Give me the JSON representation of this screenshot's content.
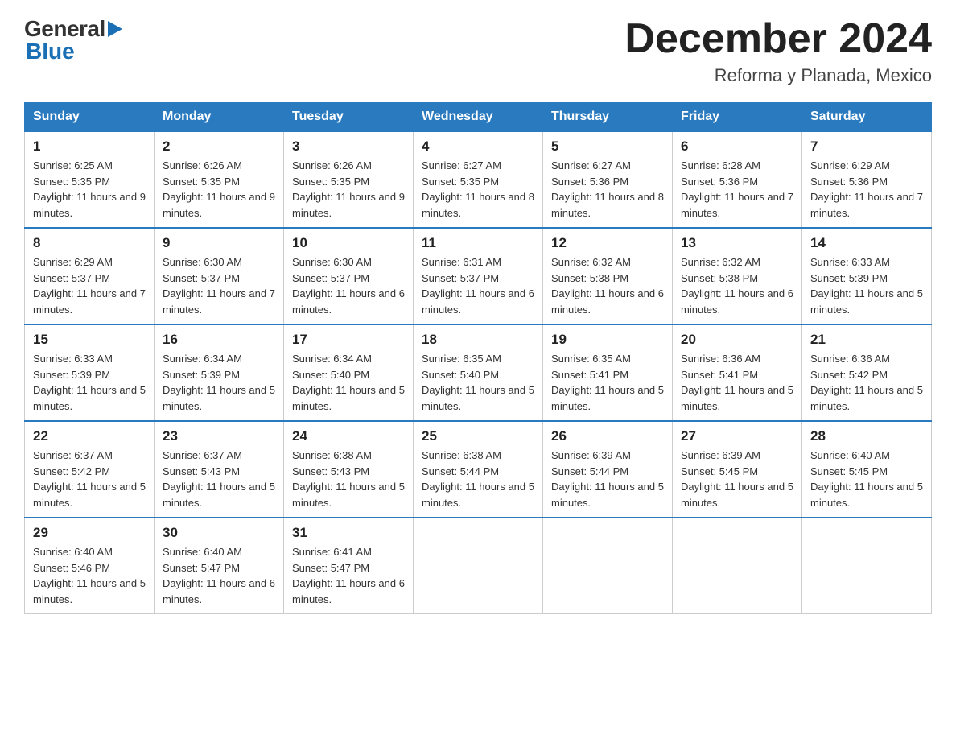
{
  "logo": {
    "general": "General",
    "blue": "Blue"
  },
  "title": {
    "month_year": "December 2024",
    "location": "Reforma y Planada, Mexico"
  },
  "days_of_week": [
    "Sunday",
    "Monday",
    "Tuesday",
    "Wednesday",
    "Thursday",
    "Friday",
    "Saturday"
  ],
  "weeks": [
    [
      {
        "num": "1",
        "sunrise": "6:25 AM",
        "sunset": "5:35 PM",
        "daylight": "11 hours and 9 minutes."
      },
      {
        "num": "2",
        "sunrise": "6:26 AM",
        "sunset": "5:35 PM",
        "daylight": "11 hours and 9 minutes."
      },
      {
        "num": "3",
        "sunrise": "6:26 AM",
        "sunset": "5:35 PM",
        "daylight": "11 hours and 9 minutes."
      },
      {
        "num": "4",
        "sunrise": "6:27 AM",
        "sunset": "5:35 PM",
        "daylight": "11 hours and 8 minutes."
      },
      {
        "num": "5",
        "sunrise": "6:27 AM",
        "sunset": "5:36 PM",
        "daylight": "11 hours and 8 minutes."
      },
      {
        "num": "6",
        "sunrise": "6:28 AM",
        "sunset": "5:36 PM",
        "daylight": "11 hours and 7 minutes."
      },
      {
        "num": "7",
        "sunrise": "6:29 AM",
        "sunset": "5:36 PM",
        "daylight": "11 hours and 7 minutes."
      }
    ],
    [
      {
        "num": "8",
        "sunrise": "6:29 AM",
        "sunset": "5:37 PM",
        "daylight": "11 hours and 7 minutes."
      },
      {
        "num": "9",
        "sunrise": "6:30 AM",
        "sunset": "5:37 PM",
        "daylight": "11 hours and 7 minutes."
      },
      {
        "num": "10",
        "sunrise": "6:30 AM",
        "sunset": "5:37 PM",
        "daylight": "11 hours and 6 minutes."
      },
      {
        "num": "11",
        "sunrise": "6:31 AM",
        "sunset": "5:37 PM",
        "daylight": "11 hours and 6 minutes."
      },
      {
        "num": "12",
        "sunrise": "6:32 AM",
        "sunset": "5:38 PM",
        "daylight": "11 hours and 6 minutes."
      },
      {
        "num": "13",
        "sunrise": "6:32 AM",
        "sunset": "5:38 PM",
        "daylight": "11 hours and 6 minutes."
      },
      {
        "num": "14",
        "sunrise": "6:33 AM",
        "sunset": "5:39 PM",
        "daylight": "11 hours and 5 minutes."
      }
    ],
    [
      {
        "num": "15",
        "sunrise": "6:33 AM",
        "sunset": "5:39 PM",
        "daylight": "11 hours and 5 minutes."
      },
      {
        "num": "16",
        "sunrise": "6:34 AM",
        "sunset": "5:39 PM",
        "daylight": "11 hours and 5 minutes."
      },
      {
        "num": "17",
        "sunrise": "6:34 AM",
        "sunset": "5:40 PM",
        "daylight": "11 hours and 5 minutes."
      },
      {
        "num": "18",
        "sunrise": "6:35 AM",
        "sunset": "5:40 PM",
        "daylight": "11 hours and 5 minutes."
      },
      {
        "num": "19",
        "sunrise": "6:35 AM",
        "sunset": "5:41 PM",
        "daylight": "11 hours and 5 minutes."
      },
      {
        "num": "20",
        "sunrise": "6:36 AM",
        "sunset": "5:41 PM",
        "daylight": "11 hours and 5 minutes."
      },
      {
        "num": "21",
        "sunrise": "6:36 AM",
        "sunset": "5:42 PM",
        "daylight": "11 hours and 5 minutes."
      }
    ],
    [
      {
        "num": "22",
        "sunrise": "6:37 AM",
        "sunset": "5:42 PM",
        "daylight": "11 hours and 5 minutes."
      },
      {
        "num": "23",
        "sunrise": "6:37 AM",
        "sunset": "5:43 PM",
        "daylight": "11 hours and 5 minutes."
      },
      {
        "num": "24",
        "sunrise": "6:38 AM",
        "sunset": "5:43 PM",
        "daylight": "11 hours and 5 minutes."
      },
      {
        "num": "25",
        "sunrise": "6:38 AM",
        "sunset": "5:44 PM",
        "daylight": "11 hours and 5 minutes."
      },
      {
        "num": "26",
        "sunrise": "6:39 AM",
        "sunset": "5:44 PM",
        "daylight": "11 hours and 5 minutes."
      },
      {
        "num": "27",
        "sunrise": "6:39 AM",
        "sunset": "5:45 PM",
        "daylight": "11 hours and 5 minutes."
      },
      {
        "num": "28",
        "sunrise": "6:40 AM",
        "sunset": "5:45 PM",
        "daylight": "11 hours and 5 minutes."
      }
    ],
    [
      {
        "num": "29",
        "sunrise": "6:40 AM",
        "sunset": "5:46 PM",
        "daylight": "11 hours and 5 minutes."
      },
      {
        "num": "30",
        "sunrise": "6:40 AM",
        "sunset": "5:47 PM",
        "daylight": "11 hours and 6 minutes."
      },
      {
        "num": "31",
        "sunrise": "6:41 AM",
        "sunset": "5:47 PM",
        "daylight": "11 hours and 6 minutes."
      },
      null,
      null,
      null,
      null
    ]
  ]
}
